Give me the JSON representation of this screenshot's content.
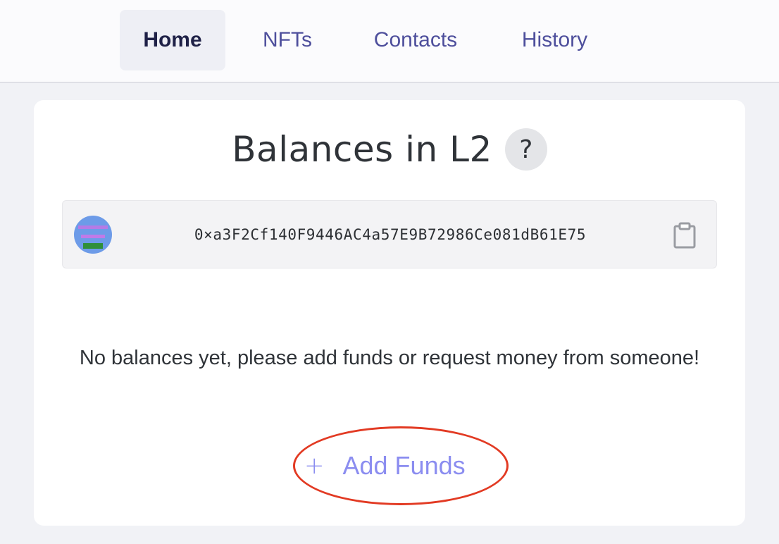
{
  "nav": {
    "tabs": [
      {
        "label": "Home",
        "active": true
      },
      {
        "label": "NFTs",
        "active": false
      },
      {
        "label": "Contacts",
        "active": false
      },
      {
        "label": "History",
        "active": false
      }
    ]
  },
  "balances": {
    "title": "Balances in L2",
    "help_label": "?",
    "address": "0×a3F2Cf140F9446AC4a57E9B72986Ce081dB61E75",
    "copy_icon": "clipboard-icon",
    "empty_message": "No balances yet, please add funds or request money from someone!",
    "add_funds": {
      "icon": "+",
      "label": "Add Funds"
    }
  },
  "colors": {
    "accent": "#8b8df0",
    "nav_text": "#4e4f9c",
    "highlight": "#e23a23"
  }
}
